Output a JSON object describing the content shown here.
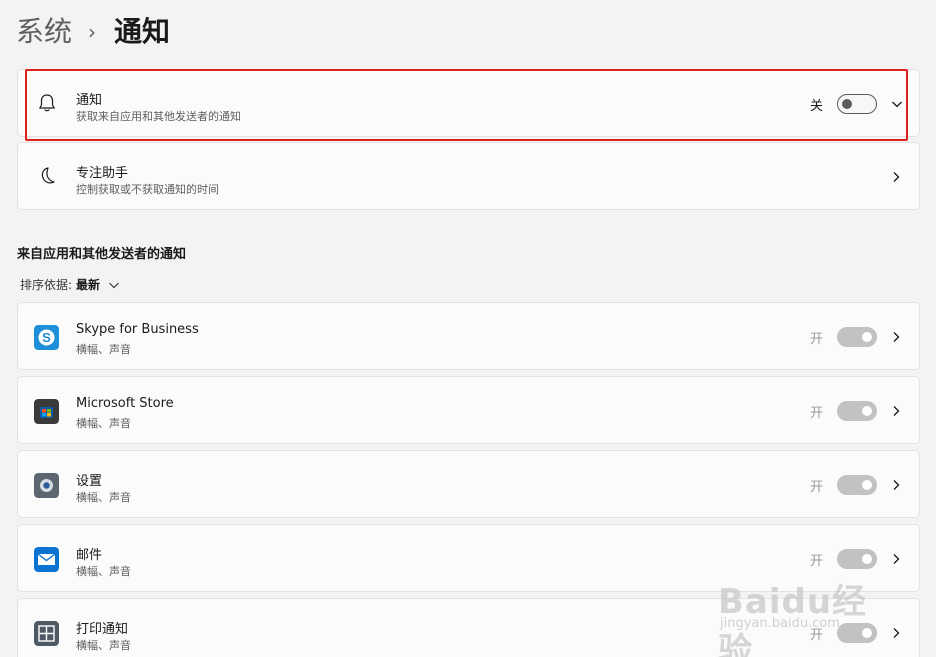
{
  "breadcrumb": {
    "parent": "系统",
    "separator": "›",
    "current": "通知"
  },
  "notifications_row": {
    "title": "通知",
    "subtitle": "获取来自应用和其他发送者的通知",
    "state": "关",
    "toggle_on": false,
    "icon": "bell-icon"
  },
  "focus_row": {
    "title": "专注助手",
    "subtitle": "控制获取或不获取通知的时间",
    "icon": "moon-icon"
  },
  "section_title": "来自应用和其他发送者的通知",
  "sort": {
    "label": "排序依据:",
    "value": "最新"
  },
  "apps": [
    {
      "name": "Skype for Business",
      "detail": "横幅、声音",
      "state": "开",
      "icon": "skype-icon",
      "color": "#1e8fd8"
    },
    {
      "name": "Microsoft Store",
      "detail": "横幅、声音",
      "state": "开",
      "icon": "store-icon",
      "color": "#3a3a3a"
    },
    {
      "name": "设置",
      "detail": "横幅、声音",
      "state": "开",
      "icon": "settings-gear-icon",
      "color": "#5b6670"
    },
    {
      "name": "邮件",
      "detail": "横幅、声音",
      "state": "开",
      "icon": "mail-icon",
      "color": "#0a72d1"
    },
    {
      "name": "打印通知",
      "detail": "横幅、声音",
      "state": "开",
      "icon": "print-notification-icon",
      "color": "#4d5a66"
    }
  ],
  "watermark": {
    "brand": "Baidu经验",
    "url": "jingyan.baidu.com"
  },
  "colors": {
    "background": "#f3f3f3",
    "card": "#fbfbfb",
    "highlight": "#e01f1f",
    "toggle_disabled": "#c2c2c2"
  }
}
